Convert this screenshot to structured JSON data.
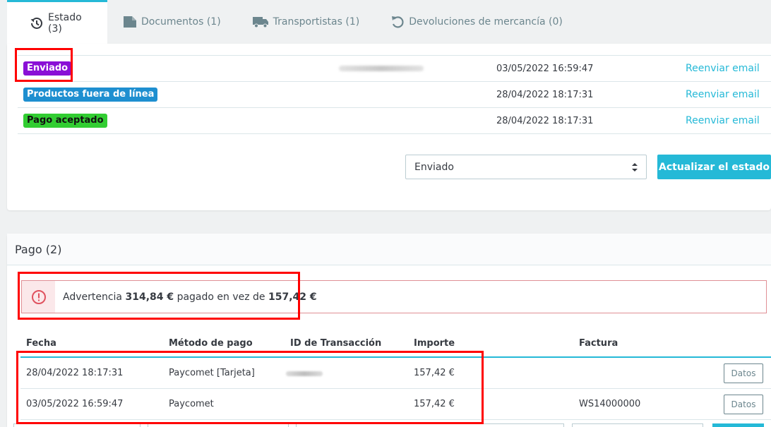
{
  "tabs": [
    {
      "label": "Estado (3)",
      "icon": "history-icon",
      "active": true
    },
    {
      "label": "Documentos (1)",
      "icon": "file-icon"
    },
    {
      "label": "Transportistas (1)",
      "icon": "truck-icon"
    },
    {
      "label": "Devoluciones de mercancía (0)",
      "icon": "undo-icon"
    }
  ],
  "status": {
    "rows": [
      {
        "badge": "Enviado",
        "color": "#8a0fd6",
        "date": "03/05/2022 16:59:47",
        "action": "Reenviar email"
      },
      {
        "badge": "Productos fuera de línea",
        "color": "#1e8fd0",
        "date": "28/04/2022 18:17:31",
        "action": "Reenviar email"
      },
      {
        "badge": "Pago aceptado",
        "color": "#32cd32",
        "date": "28/04/2022 18:17:31",
        "action": "Reenviar email"
      }
    ],
    "select_value": "Enviado",
    "update_button": "Actualizar el estado"
  },
  "payment": {
    "title": "Pago (2)",
    "alert": {
      "prefix": "Advertencia",
      "paid": "314,84 €",
      "middle": "pagado en vez de",
      "expected": "157,42 €"
    },
    "columns": [
      "Fecha",
      "Método de pago",
      "ID de Transacción",
      "Importe",
      "Factura"
    ],
    "rows": [
      {
        "date": "28/04/2022 18:17:31",
        "method": "Paycomet [Tarjeta]",
        "amount": "157,42 €",
        "invoice": "",
        "button": "Datos"
      },
      {
        "date": "03/05/2022 16:59:47",
        "method": "Paycomet",
        "amount": "157,42 €",
        "invoice": "WS14000000",
        "button": "Datos"
      }
    ]
  },
  "colors": {
    "accent": "#25b9d7",
    "highlight": "#ff0000",
    "alert_border": "#e08f95"
  }
}
